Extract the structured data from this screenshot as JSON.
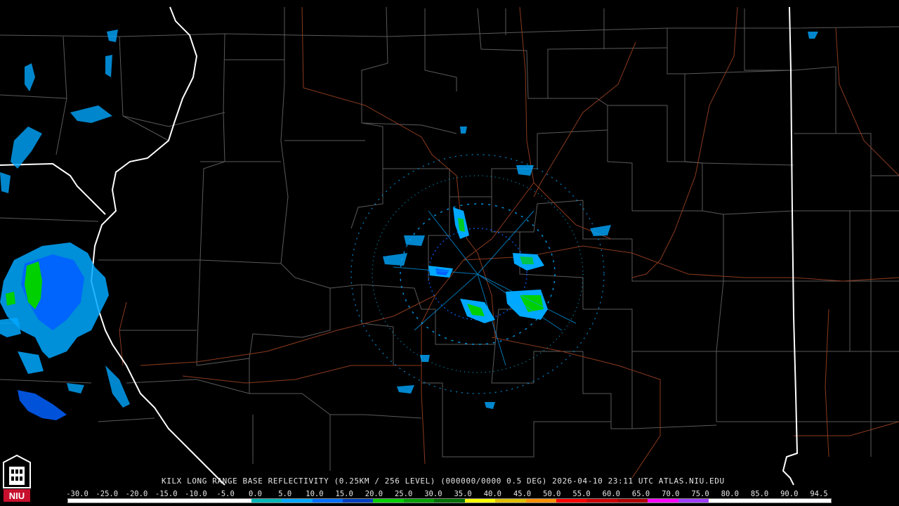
{
  "product": {
    "title": "KILX LONG RANGE BASE REFLECTIVITY (0.25KM / 256 LEVEL) (000000/0000 0.5 DEG) 2026-04-10 23:11 UTC  ATLAS.NIU.EDU"
  },
  "logo": {
    "text": "NIU",
    "color": "#c8102e"
  },
  "colorbar": {
    "labels": [
      "-30.0",
      "-25.0",
      "-20.0",
      "-15.0",
      "-10.0",
      "-5.0",
      "0.0",
      "5.0",
      "10.0",
      "15.0",
      "20.0",
      "25.0",
      "30.0",
      "35.0",
      "40.0",
      "45.0",
      "50.0",
      "55.0",
      "60.0",
      "65.0",
      "70.0",
      "75.0",
      "80.0",
      "85.0",
      "90.0",
      "94.5"
    ],
    "colors": [
      "#ffffff",
      "#ffffff",
      "#ffffff",
      "#ffffff",
      "#ffffff",
      "#ffffff",
      "#00b7b7",
      "#00a8ff",
      "#0070ff",
      "#0040c0",
      "#00d000",
      "#00a000",
      "#007000",
      "#ffff00",
      "#e0c000",
      "#ff9000",
      "#ff0000",
      "#d00000",
      "#b00000",
      "#ff00ff",
      "#a040ff",
      "#ffffff",
      "#ffffff",
      "#ffffff",
      "#ffffff"
    ]
  },
  "map_colors": {
    "county_lines": "#5a5a5a",
    "state_lines": "#ffffff",
    "highways": "#8b3a1e",
    "echo_light": "#00c8ff",
    "echo_mid": "#0060ff",
    "echo_strong": "#00d000"
  }
}
